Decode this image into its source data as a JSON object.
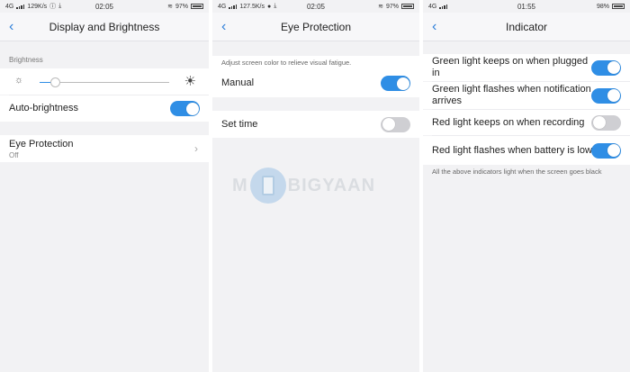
{
  "panel1": {
    "status": {
      "network": "4G",
      "speed": "129K/s",
      "time": "02:05",
      "battery": "97%"
    },
    "title": "Display and Brightness",
    "brightness": {
      "label": "Brightness",
      "level": 0.12
    },
    "auto_brightness": {
      "label": "Auto-brightness",
      "on": true
    },
    "eye_protection": {
      "label": "Eye Protection",
      "value": "Off"
    }
  },
  "panel2": {
    "status": {
      "network": "4G",
      "speed": "127.5K/s",
      "time": "02:05",
      "battery": "97%"
    },
    "title": "Eye Protection",
    "description": "Adjust screen color to relieve visual fatigue.",
    "manual": {
      "label": "Manual",
      "on": true
    },
    "set_time": {
      "label": "Set time",
      "on": false
    }
  },
  "panel3": {
    "status": {
      "network": "4G",
      "time": "01:55",
      "battery": "98%"
    },
    "title": "Indicator",
    "items": [
      {
        "label": "Green light keeps on when plugged in",
        "on": true
      },
      {
        "label": "Green light flashes when notification arrives",
        "on": true
      },
      {
        "label": "Red light keeps on when recording",
        "on": false
      },
      {
        "label": "Red light flashes when battery is low",
        "on": true
      }
    ],
    "note": "All the above indicators light when the screen goes black"
  },
  "watermark": {
    "left": "M",
    "right": "BIGYAAN"
  },
  "colors": {
    "accent": "#2f8ee5",
    "toggle_off": "#cfcfd3",
    "background": "#f2f2f4"
  }
}
